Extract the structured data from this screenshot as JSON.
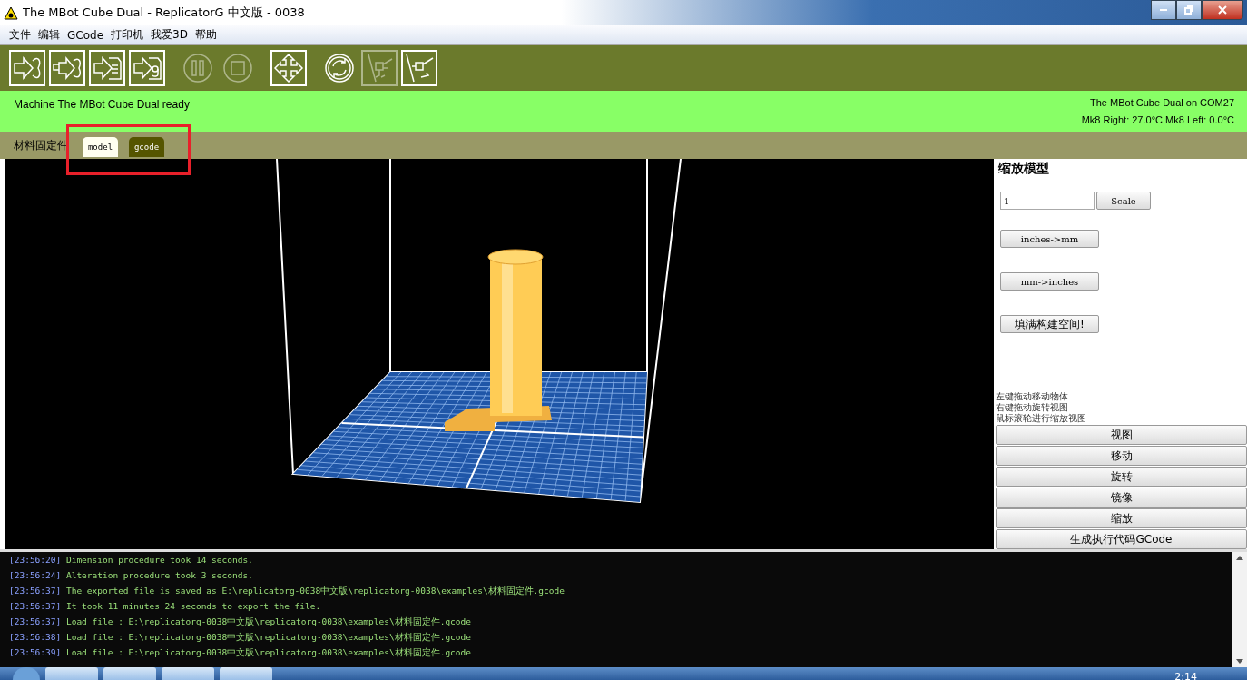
{
  "window": {
    "title": "The MBot Cube Dual - ReplicatorG 中文版 - 0038"
  },
  "menu": [
    "文件",
    "编辑",
    "GCode",
    "打印机",
    "我爱3D",
    "帮助"
  ],
  "toolbar": [
    {
      "kind": "build",
      "disabled": false
    },
    {
      "kind": "build-remote",
      "disabled": false
    },
    {
      "kind": "build-file",
      "disabled": false
    },
    {
      "kind": "gcode-file",
      "disabled": false
    },
    {
      "kind": "pause",
      "disabled": true
    },
    {
      "kind": "stop",
      "disabled": true
    },
    {
      "kind": "move",
      "disabled": false
    },
    {
      "kind": "reset",
      "disabled": false
    },
    {
      "kind": "disconnect",
      "disabled": true
    },
    {
      "kind": "connect",
      "disabled": false
    }
  ],
  "status": {
    "message": "Machine The MBot Cube Dual ready",
    "connection": "The MBot Cube Dual on COM27",
    "temperatures": "Mk8 Right: 27.0°C   Mk8 Left: 0.0°C"
  },
  "file_label": "材料固定件",
  "tabs": [
    {
      "label": "model",
      "selected": true
    },
    {
      "label": "gcode",
      "selected": false
    }
  ],
  "side_panel": {
    "title": "缩放模型",
    "scale_input": {
      "value": "1"
    },
    "scale_button": "Scale",
    "buttons": [
      "inches->mm",
      "mm->inches",
      "填满构建空间!"
    ],
    "hints": [
      "左键拖动移动物体",
      "右键拖动旋转视图",
      "鼠标滚轮进行缩放视图"
    ],
    "sections": [
      "视图",
      "移动",
      "旋转",
      "镜像",
      "缩放",
      "生成执行代码GCode"
    ]
  },
  "log": [
    {
      "time": "[23:56:20]",
      "message": "Dimension procedure took 14 seconds."
    },
    {
      "time": "[23:56:24]",
      "message": "Alteration procedure took 3 seconds."
    },
    {
      "time": "[23:56:37]",
      "message": "The exported file is saved as E:\\replicatorg-0038中文版\\replicatorg-0038\\examples\\材料固定件.gcode"
    },
    {
      "time": "[23:56:37]",
      "message": "It took 11 minutes 24 seconds to export the file."
    },
    {
      "time": "[23:56:37]",
      "message": "Load file : E:\\replicatorg-0038中文版\\replicatorg-0038\\examples\\材料固定件.gcode"
    },
    {
      "time": "[23:56:38]",
      "message": "Load file : E:\\replicatorg-0038中文版\\replicatorg-0038\\examples\\材料固定件.gcode"
    },
    {
      "time": "[23:56:39]",
      "message": "Load file : E:\\replicatorg-0038中文版\\replicatorg-0038\\examples\\材料固定件.gcode"
    }
  ],
  "taskbar": {
    "clock": "2:14"
  }
}
